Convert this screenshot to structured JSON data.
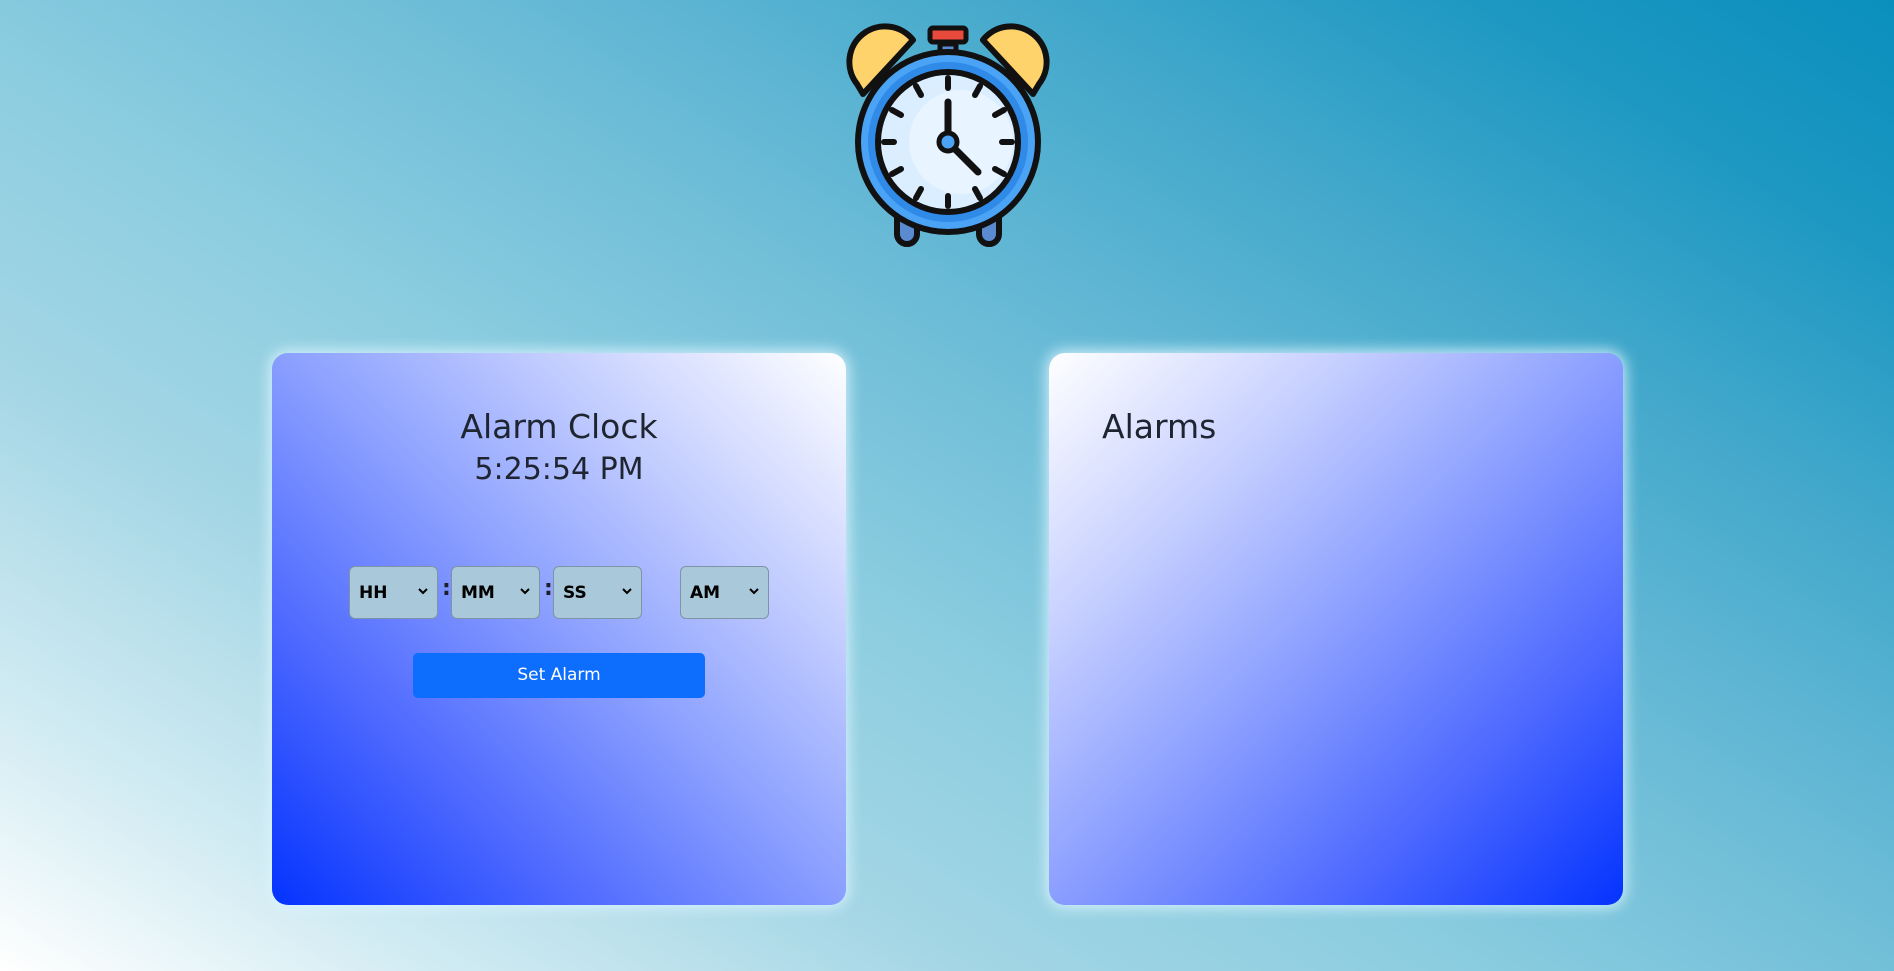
{
  "logo": {
    "icon": "alarm-clock-icon"
  },
  "clock_panel": {
    "title": "Alarm Clock",
    "current_time": "5:25:54 PM",
    "hour_select": {
      "value": "HH",
      "icon": "chevron-down-icon"
    },
    "minute_select": {
      "value": "MM",
      "icon": "chevron-down-icon"
    },
    "second_select": {
      "value": "SS",
      "icon": "chevron-down-icon"
    },
    "ampm_select": {
      "value": "AM",
      "icon": "chevron-down-icon"
    },
    "separator": ":",
    "set_button_label": "Set Alarm",
    "set_button_color": "#0d6efd"
  },
  "alarms_panel": {
    "title": "Alarms",
    "items": []
  }
}
